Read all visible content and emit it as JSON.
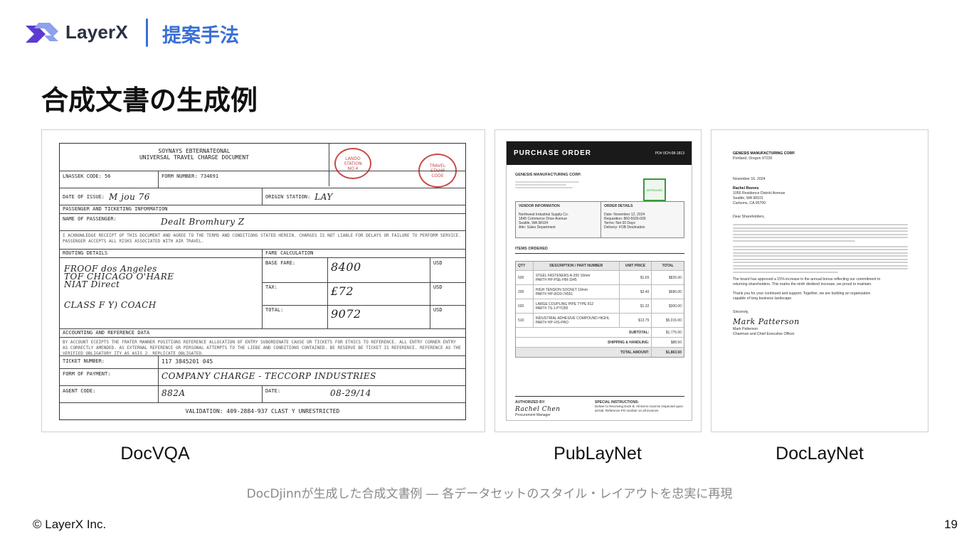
{
  "header": {
    "brand": "LayerX",
    "section_title": "提案手法"
  },
  "page_title": "合成文書の生成例",
  "cards": [
    {
      "caption": "DocVQA"
    },
    {
      "caption": "PubLayNet"
    },
    {
      "caption": "DocLayNet"
    }
  ],
  "docvqa": {
    "org_line1": "SOYNAYS EBTERNATEONAL",
    "org_line2": "UNIVERSAL TRAVEL CHARGE DOCUMENT",
    "stamp1": "LANDO\nSTATION\nNO.4",
    "stamp2": "TRAVEL\nSTAMP\nCODE",
    "passenger_code_label": "LNASSEK CODE: 56",
    "form_number_label": "FORM NUMBER: 734691",
    "date_label": "DATE OF ISSUE:",
    "date_value": "M jou 76",
    "origin_label": "ORIGIN STATION:",
    "origin_value": "LAY",
    "passenger_section": "PASSENGER AND TICKETING INFORMATION",
    "passenger_label": "NAME OF PASSENGER:",
    "passenger_value": "Dealt Bromhury Z",
    "terms_text": "I ACKNOWLEDGE RECEIPT OF THIS DOCUMENT AND AGREE TO THE TERMS AND CONDITIONS STATED HEREIN. CHARGES IS NOT LIABLE FOR DELAYS OR FAILURE TO PERFORM SERVICE. PASSENGER ACCEPTS ALL RISKS ASSOCIATED WITH AIR TRAVEL.",
    "routing_label": "ROUTING DETAILS",
    "fare_label": "FARE CALCULATION",
    "routing_lines": [
      "FROOF dos Angeles",
      "TOF CHICAGO O'HARE",
      "NIAT Direct",
      "CLASS F Y) COACH"
    ],
    "base_fare_label": "BASE FARE:",
    "base_fare_value": "8400",
    "tax_label": "TAX:",
    "tax_value": "£72",
    "total_label": "TOTAL:",
    "total_value": "9072",
    "currency": "USD",
    "accounting_label": "ACCOUNTING AND REFERENCE DATA",
    "accounting_text": "BY ACCOUNT ECEIPTS THE FRATER MANNER POSITIONS REFERENCE ALLOCATION OF ENTRY SUBORDINATE CAUSE OR TICKETS FOR ETHICS TO REFERENCE. ALL ENTRY CORNER ENTRY AS CORRECTLY AMENDED. AS EXTERNAL REFERENCE OR PERSONAL ATTEMPTS TO THE LIEBE AND CONDITIONS CONTAINED. BE RESERVE BE TICKET IS REFERENCE. REFERENCE AS THE VERIFIED OBLIGATORY ITY AS ASIS 2. REPLICATE OBLIGATED.",
    "ticket_label": "TICKET NUMBER:",
    "ticket_value": "117 3845201 045",
    "payment_label": "FORM OF PAYMENT:",
    "payment_value": "COMPANY CHARGE - TECCORP INDUSTRIES",
    "agent_label": "AGENT CODE:",
    "agent_value": "882A",
    "agent_date_label": "DATE:",
    "agent_date_value": "08-29/14",
    "validation": "VALIDATION: 409-2884-937 CLAST Y UNRESTRICTED"
  },
  "publaynet": {
    "title": "PURCHASE ORDER",
    "po_number": "PO# 0CH-08-1813",
    "company": "GENESIS MANUFACTURING CORP.",
    "stamp": "APPROVED",
    "vendor_heading": "VENDOR INFORMATION",
    "vendor_lines": [
      "Northwest Industrial Supply Co.",
      "1845 Commerce Drive Avenue",
      "Seattle, WA 98104",
      "Attn: Sales Department"
    ],
    "order_heading": "ORDER DETAILS",
    "order_lines": [
      "Date: November 12, 2024",
      "Requisition: 860-5926-006",
      "Terms: Net 30 Days",
      "Delivery: FOB Destination"
    ],
    "items_heading": "ITEMS ORDERED",
    "table_headers": [
      "QTY",
      "DESCRIPTION / PART NUMBER",
      "UNIT PRICE",
      "TOTAL"
    ],
    "rows": [
      [
        "500",
        "STEEL FASTENERS A-200 16mm\nPART# HP-PSE-HM-1545",
        "$1.65",
        "$825.00"
      ],
      [
        "200",
        "HIGH TENSION SOCKET 10mm\nPART# HP-0020-74551",
        "$3.40",
        "$680.00"
      ],
      [
        "020",
        "LARGE COUPLING PIPE TYPE 812\nPART# TS-1-PTCB5",
        "$1.32",
        "$300.00"
      ],
      [
        "510",
        "INDUSTRIAL ADHESIVE COMPOUND HIGHL\nPART# HP-VIS-PRO",
        "$13.75",
        "$5,015.00"
      ]
    ],
    "subtotal_label": "SUBTOTAL:",
    "subtotal_value": "$1,775.00",
    "shipping_label": "SHIPPING & HANDLING:",
    "shipping_value": "$88.50",
    "total_label": "TOTAL AMOUNT:",
    "total_value": "$1,863.50",
    "authorized_label": "AUTHORIZED BY:",
    "signature": "Rachel Chen",
    "signer_title": "Procurement Manager",
    "instructions_label": "SPECIAL INSTRUCTIONS:",
    "instructions_text": "Deliver to Receiving Dock B. All items must be inspected upon arrival. Reference PO number on all invoices."
  },
  "doclaynet": {
    "company": "GENESIS MANUFACTURING CORP.",
    "city": "Portland, Oregon 97230",
    "date": "November 16, 2024",
    "recipient_name": "Rachel Reeves",
    "recipient_lines": [
      "1056 Residence District Avenue",
      "Seattle, WA 98101",
      "Carlsons, CA 95700"
    ],
    "salutation": "Dear Shareholders,",
    "closing_line1": "The board has approved a 15% increase in the annual bonus reflecting our commitment to",
    "closing_line2": "returning shareholders. This marks the ninth dividend increase, we proud to maintain.",
    "thanks_line1": "Thank you for your continued and support. Together, we are building an organization",
    "thanks_line2": "capable of long business landscape.",
    "signoff": "Sincerely,",
    "signature": "Mark Patterson",
    "signer_name": "Mark Patterson",
    "signer_title": "Chairman and Chief Executive Officer"
  },
  "subcaption": "DocDjinnが生成した合成文書例 ― 各データセットのスタイル・レイアウトを忠実に再現",
  "footer": {
    "copyright": "© LayerX Inc.",
    "page_number": "19"
  },
  "colors": {
    "accent": "#3a6fd6",
    "logo_light": "#8da2ee",
    "logo_dark": "#5b3bd1",
    "stamp_red": "#c94a4a",
    "stamp_green": "#3a9a3a"
  }
}
